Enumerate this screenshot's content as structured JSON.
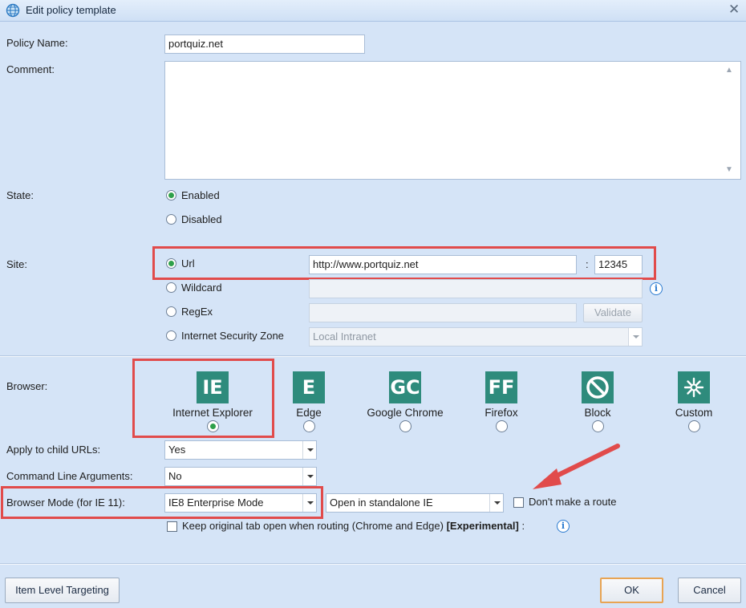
{
  "window": {
    "title": "Edit policy template",
    "icon": "globe-icon",
    "close_icon": "close-icon"
  },
  "policy_name": {
    "label": "Policy Name:",
    "value": "portquiz.net"
  },
  "comment": {
    "label": "Comment:",
    "value": ""
  },
  "state": {
    "label": "State:",
    "options": [
      "Enabled",
      "Disabled"
    ],
    "selected": "Enabled"
  },
  "site": {
    "label": "Site:",
    "url": {
      "label": "Url",
      "value": "http://www.portquiz.net",
      "port_sep": ":",
      "port": "12345",
      "selected": true
    },
    "wildcard": {
      "label": "Wildcard",
      "value": ""
    },
    "regex": {
      "label": "RegEx",
      "value": "",
      "validate_label": "Validate"
    },
    "zone": {
      "label": "Internet Security Zone",
      "value": "Local Intranet"
    }
  },
  "browser": {
    "label": "Browser:",
    "items": [
      {
        "tile": "IE",
        "label": "Internet Explorer",
        "selected": true
      },
      {
        "tile": "E",
        "label": "Edge",
        "selected": false
      },
      {
        "tile": "GC",
        "label": "Google Chrome",
        "selected": false
      },
      {
        "tile": "FF",
        "label": "Firefox",
        "selected": false
      },
      {
        "tile": "block-icon",
        "label": "Block",
        "selected": false
      },
      {
        "tile": "custom-icon",
        "label": "Custom",
        "selected": false
      }
    ],
    "tile_color": "#2e8b7c"
  },
  "apply_child": {
    "label": "Apply to child URLs:",
    "value": "Yes"
  },
  "cmd_args": {
    "label": "Command Line Arguments:",
    "value": "No"
  },
  "browser_mode": {
    "label": "Browser Mode (for IE 11):",
    "value": "IE8 Enterprise Mode",
    "open_mode": "Open in standalone IE"
  },
  "dont_route": {
    "label": "Don't make a route",
    "checked": false
  },
  "keep_tab": {
    "label": "Keep original tab open when routing (Chrome and Edge)",
    "experimental": "[Experimental]",
    "suffix": ":",
    "checked": false
  },
  "footer": {
    "ilt_label": "Item Level Targeting",
    "ok_label": "OK",
    "cancel_label": "Cancel"
  },
  "annotation_color": "#e14b4b"
}
